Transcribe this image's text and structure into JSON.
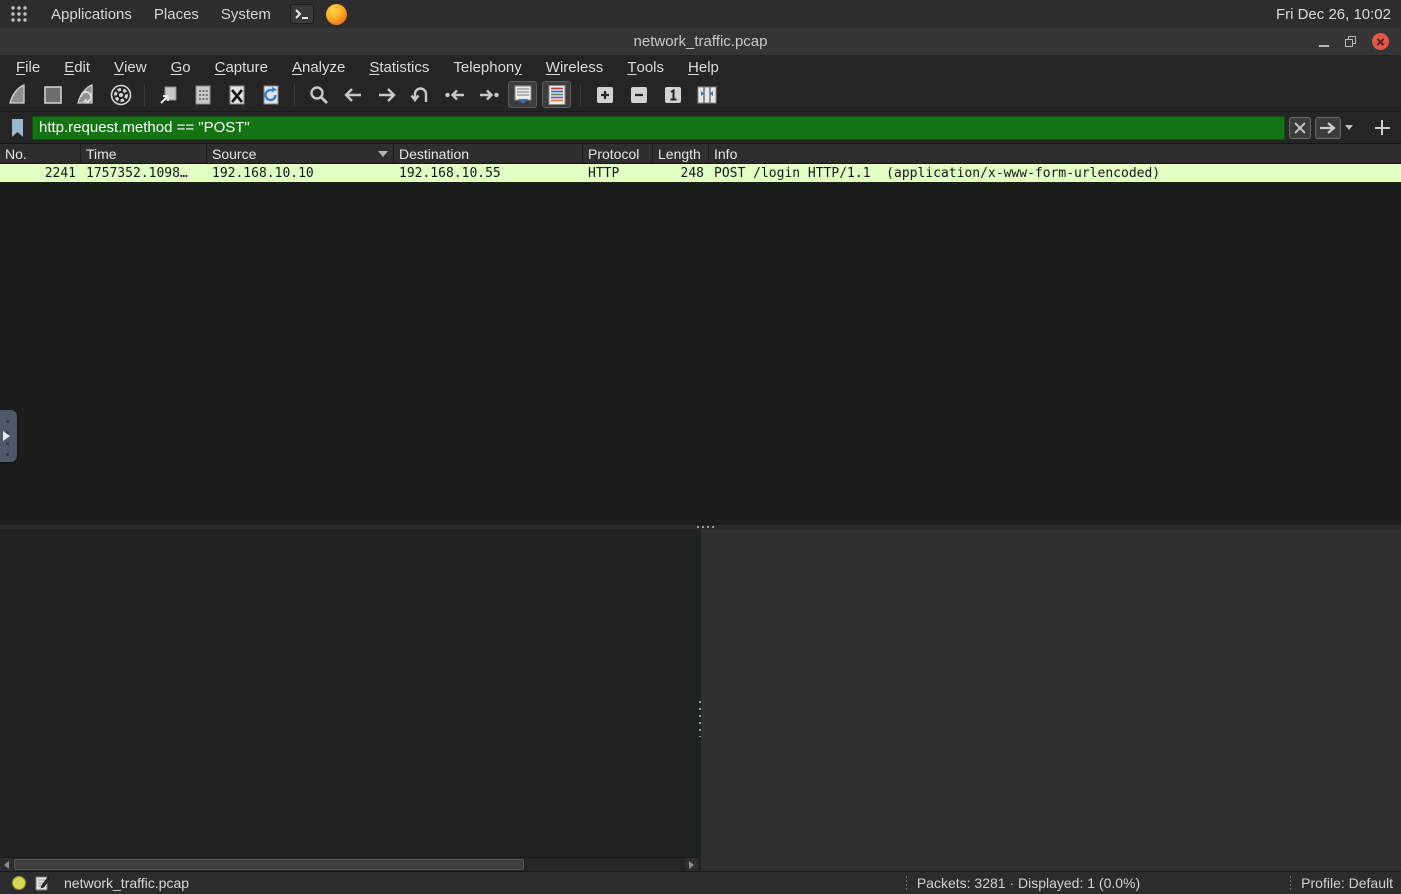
{
  "desktop_bar": {
    "menus": [
      "Applications",
      "Places",
      "System"
    ],
    "clock": "Fri Dec 26, 10:02"
  },
  "window": {
    "title": "network_traffic.pcap",
    "controls": [
      "minimize",
      "restore",
      "close"
    ]
  },
  "menu_bar": {
    "items": [
      {
        "pre": "",
        "key": "F",
        "rest": "ile"
      },
      {
        "pre": "",
        "key": "E",
        "rest": "dit"
      },
      {
        "pre": "",
        "key": "V",
        "rest": "iew"
      },
      {
        "pre": "",
        "key": "G",
        "rest": "o"
      },
      {
        "pre": "",
        "key": "C",
        "rest": "apture"
      },
      {
        "pre": "",
        "key": "A",
        "rest": "nalyze"
      },
      {
        "pre": "",
        "key": "S",
        "rest": "tatistics"
      },
      {
        "pre": "Telephon",
        "key": "y",
        "rest": ""
      },
      {
        "pre": "",
        "key": "W",
        "rest": "ireless"
      },
      {
        "pre": "",
        "key": "T",
        "rest": "ools"
      },
      {
        "pre": "",
        "key": "H",
        "rest": "elp"
      }
    ]
  },
  "toolbar": {
    "icons": [
      "start-capture",
      "stop-capture",
      "restart-capture",
      "capture-options",
      "open-file",
      "save-file",
      "close-file",
      "reload-file",
      "find-packet",
      "go-back",
      "go-forward",
      "go-to-packet",
      "go-first-packet",
      "go-last-packet",
      "auto-scroll",
      "colorize-packets",
      "zoom-in",
      "zoom-out",
      "zoom-original",
      "resize-columns"
    ]
  },
  "filter_bar": {
    "value": "http.request.method == \"POST\""
  },
  "packet_list": {
    "columns": [
      "No.",
      "Time",
      "Source",
      "Destination",
      "Protocol",
      "Length",
      "Info"
    ],
    "sort_column": "Source",
    "sort_direction": "descending",
    "rows": [
      {
        "no": "2241",
        "time": "1757352.1098…",
        "source": "192.168.10.10",
        "destination": "192.168.10.55",
        "protocol": "HTTP",
        "length": "248",
        "info": "POST /login HTTP/1.1  (application/x-www-form-urlencoded)"
      }
    ]
  },
  "status_bar": {
    "file_name": "network_traffic.pcap",
    "packets_summary": "Packets: 3281 · Displayed: 1 (0.0%)",
    "profile": "Profile: Default"
  },
  "colors": {
    "filter_valid_bg": "#147414",
    "http_row_bg": "#e2ffc4",
    "close_button": "#e2574a",
    "panel_bg": "#2d2d2d",
    "expert_indicator": "#d8d855"
  }
}
